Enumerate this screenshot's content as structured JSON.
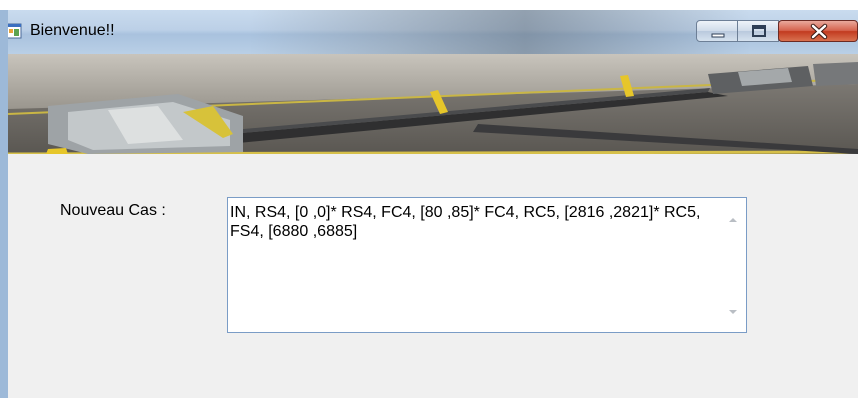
{
  "window": {
    "title": "Bienvenue!!",
    "controls": {
      "minimize_icon": "minimize-icon",
      "maximize_icon": "maximize-icon",
      "close_icon": "close-icon"
    }
  },
  "banner": {
    "image": "airport-jetway-tarmac-banner"
  },
  "form": {
    "new_case_label": "Nouveau Cas  :",
    "new_case_value": "IN, RS4, [0 ,0]* RS4, FC4, [80 ,85]* FC4, RC5, [2816 ,2821]* RC5, FS4, [6880 ,6885]"
  },
  "colors": {
    "window_bg": "#f0f0f0",
    "close_button": "#c94a30",
    "textbox_border": "#7a9cc6"
  }
}
